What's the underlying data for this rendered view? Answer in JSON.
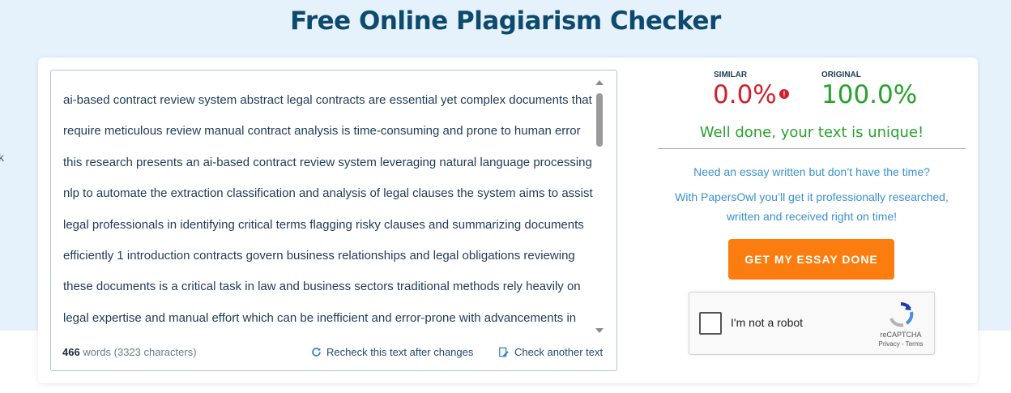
{
  "page": {
    "title": "Free Online Plagiarism Checker",
    "edge_char": "k"
  },
  "editor": {
    "lines": [
      "ai-based contract review system abstract legal contracts are essential yet complex documents that",
      "require meticulous review manual contract analysis is time-consuming and prone to human error",
      "this research presents an ai-based contract review system leveraging natural language processing",
      "nlp to automate the extraction classification and analysis of legal clauses the system aims to assist",
      "legal professionals in identifying critical terms flagging risky clauses and summarizing documents",
      "efficiently 1 introduction contracts govern business relationships and legal obligations reviewing",
      "these documents is a critical task in law and business sectors traditional methods rely heavily on",
      "legal expertise and manual effort which can be inefficient and error-prone with advancements in"
    ],
    "word_count": "466",
    "words_label": "words",
    "char_count": "3323",
    "chars_label": "characters",
    "recheck_label": "Recheck this text after changes",
    "check_another_label": "Check another text",
    "recheck_icon": "refresh-icon",
    "check_another_icon": "document-edit-icon"
  },
  "results": {
    "similar_label": "SIMILAR",
    "similar_value": "0.0%",
    "original_label": "ORIGINAL",
    "original_value": "100.0%",
    "unique_message": "Well done, your text is unique!",
    "similar_color": "#d0202a",
    "original_color": "#27a22f"
  },
  "promo": {
    "line1": "Need an essay written but don’t have the time?",
    "line2a": "With PapersOwl you’ll get it professionally researched,",
    "line2b": "written and received right on time!",
    "cta_label": "GET MY ESSAY DONE",
    "cta_color": "#fb7c0f"
  },
  "captcha": {
    "label": "I'm not a robot",
    "brand": "reCAPTCHA",
    "links": "Privacy - Terms"
  }
}
